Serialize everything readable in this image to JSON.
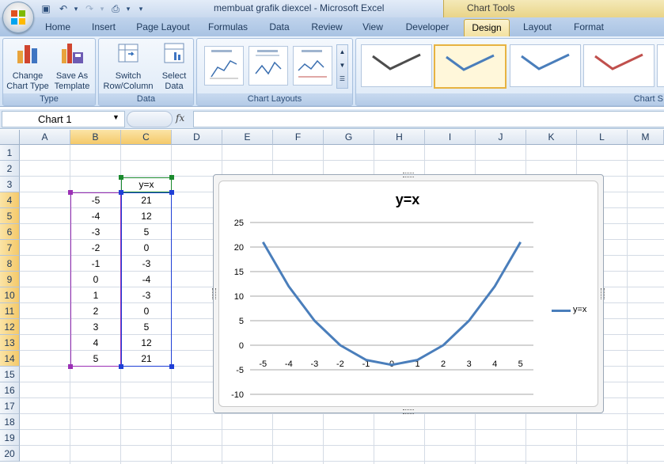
{
  "window": {
    "title": "membuat grafik diexcel - Microsoft Excel",
    "context_title": "Chart Tools"
  },
  "tabs": [
    "Home",
    "Insert",
    "Page Layout",
    "Formulas",
    "Data",
    "Review",
    "View",
    "Developer",
    "Design",
    "Layout",
    "Format"
  ],
  "active_tab": "Design",
  "ribbon": {
    "type_group": {
      "label": "Type",
      "change_chart_type": "Change\nChart Type",
      "save_as_template": "Save As\nTemplate"
    },
    "data_group": {
      "label": "Data",
      "switch_row_column": "Switch\nRow/Column",
      "select_data": "Select\nData"
    },
    "layouts_group": {
      "label": "Chart Layouts"
    },
    "styles_group": {
      "label": "Chart S",
      "style_colors": [
        "#4d4d4d",
        "#4a7ebb",
        "#4a7ebb",
        "#c0504d"
      ]
    }
  },
  "formula_bar": {
    "name_box": "Chart 1",
    "fx": "fx",
    "formula": ""
  },
  "columns": [
    "A",
    "B",
    "C",
    "D",
    "E",
    "F",
    "G",
    "H",
    "I",
    "J",
    "K",
    "L",
    "M"
  ],
  "rows": [
    "1",
    "2",
    "3",
    "4",
    "5",
    "6",
    "7",
    "8",
    "9",
    "10",
    "11",
    "12",
    "13",
    "14",
    "15",
    "16",
    "17",
    "18",
    "19",
    "20"
  ],
  "sheet": {
    "header_c3": "y=x",
    "col_b": [
      "-5",
      "-4",
      "-3",
      "-2",
      "-1",
      "0",
      "1",
      "2",
      "3",
      "4",
      "5"
    ],
    "col_c": [
      "21",
      "12",
      "5",
      "0",
      "-3",
      "-4",
      "-3",
      "0",
      "5",
      "12",
      "21"
    ]
  },
  "chart_data": {
    "type": "line",
    "title": "y=x",
    "categories": [
      "-5",
      "-4",
      "-3",
      "-2",
      "-1",
      "0",
      "1",
      "2",
      "3",
      "4",
      "5"
    ],
    "series": [
      {
        "name": "y=x",
        "values": [
          21,
          12,
          5,
          0,
          -3,
          -4,
          -3,
          0,
          5,
          12,
          21
        ],
        "color": "#4a7ebb"
      }
    ],
    "ylim": [
      -10,
      25
    ],
    "yticks": [
      "25",
      "20",
      "15",
      "10",
      "5",
      "0",
      "-5",
      "-10"
    ],
    "grid": true,
    "legend": "right"
  }
}
